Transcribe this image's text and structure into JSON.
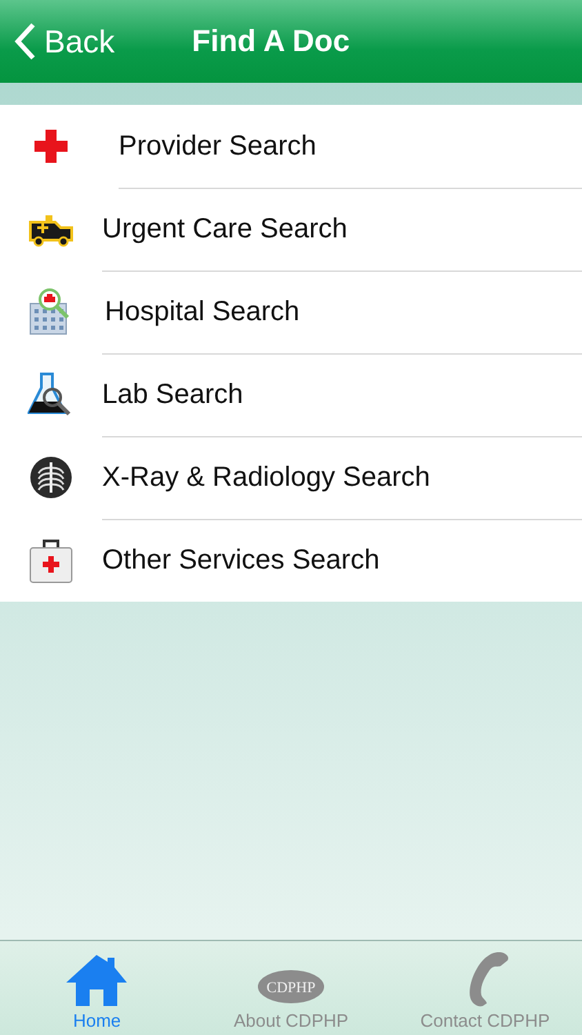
{
  "header": {
    "back": "Back",
    "title": "Find A Doc"
  },
  "menu": [
    {
      "kind": "cross",
      "label": "Provider Search"
    },
    {
      "kind": "ambulance",
      "label": "Urgent Care Search"
    },
    {
      "kind": "hospital",
      "label": "Hospital Search"
    },
    {
      "kind": "flask",
      "label": "Lab Search"
    },
    {
      "kind": "xray",
      "label": "X-Ray & Radiology Search"
    },
    {
      "kind": "kit",
      "label": "Other Services Search"
    }
  ],
  "tab_bar": [
    {
      "kind": "home",
      "label": "Home",
      "selected": true
    },
    {
      "kind": "logo",
      "label": "About CDPHP",
      "logo_text": "CDPHP",
      "selected": false
    },
    {
      "kind": "phone",
      "label": "Contact CDPHP",
      "selected": false
    }
  ]
}
